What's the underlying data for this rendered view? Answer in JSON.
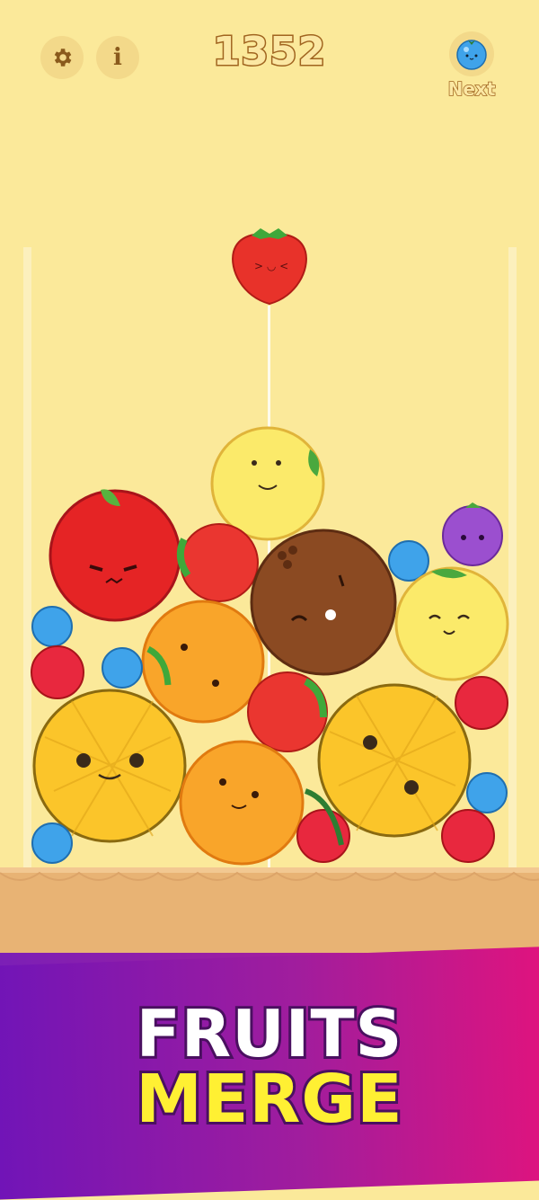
{
  "hud": {
    "settings_icon": "gear-icon",
    "info_icon": "info-icon",
    "info_symbol": "i",
    "score": "1352",
    "next_label": "Next",
    "next_fruit": "blueberry"
  },
  "banner": {
    "line1": "FRUITS",
    "line2": "MERGE"
  },
  "colors": {
    "background": "#fbe99a",
    "ground": "#e8b374",
    "score_text": "#fbe7a3",
    "score_outline": "#a0641f",
    "banner_left": "#6f14b8",
    "banner_right": "#e3137c",
    "title_white": "#ffffff",
    "title_yellow": "#fff033"
  },
  "fruits": [
    {
      "type": "strawberry",
      "state": "dropping"
    },
    {
      "type": "grapefruit"
    },
    {
      "type": "apple"
    },
    {
      "type": "strawberry"
    },
    {
      "type": "coconut"
    },
    {
      "type": "blueberry"
    },
    {
      "type": "grape"
    },
    {
      "type": "grapefruit"
    },
    {
      "type": "blueberry"
    },
    {
      "type": "orange"
    },
    {
      "type": "cherry"
    },
    {
      "type": "blueberry"
    },
    {
      "type": "strawberry"
    },
    {
      "type": "cherry"
    },
    {
      "type": "melon"
    },
    {
      "type": "melon"
    },
    {
      "type": "orange"
    },
    {
      "type": "blueberry"
    },
    {
      "type": "cherry"
    },
    {
      "type": "cherry"
    },
    {
      "type": "blueberry"
    }
  ]
}
